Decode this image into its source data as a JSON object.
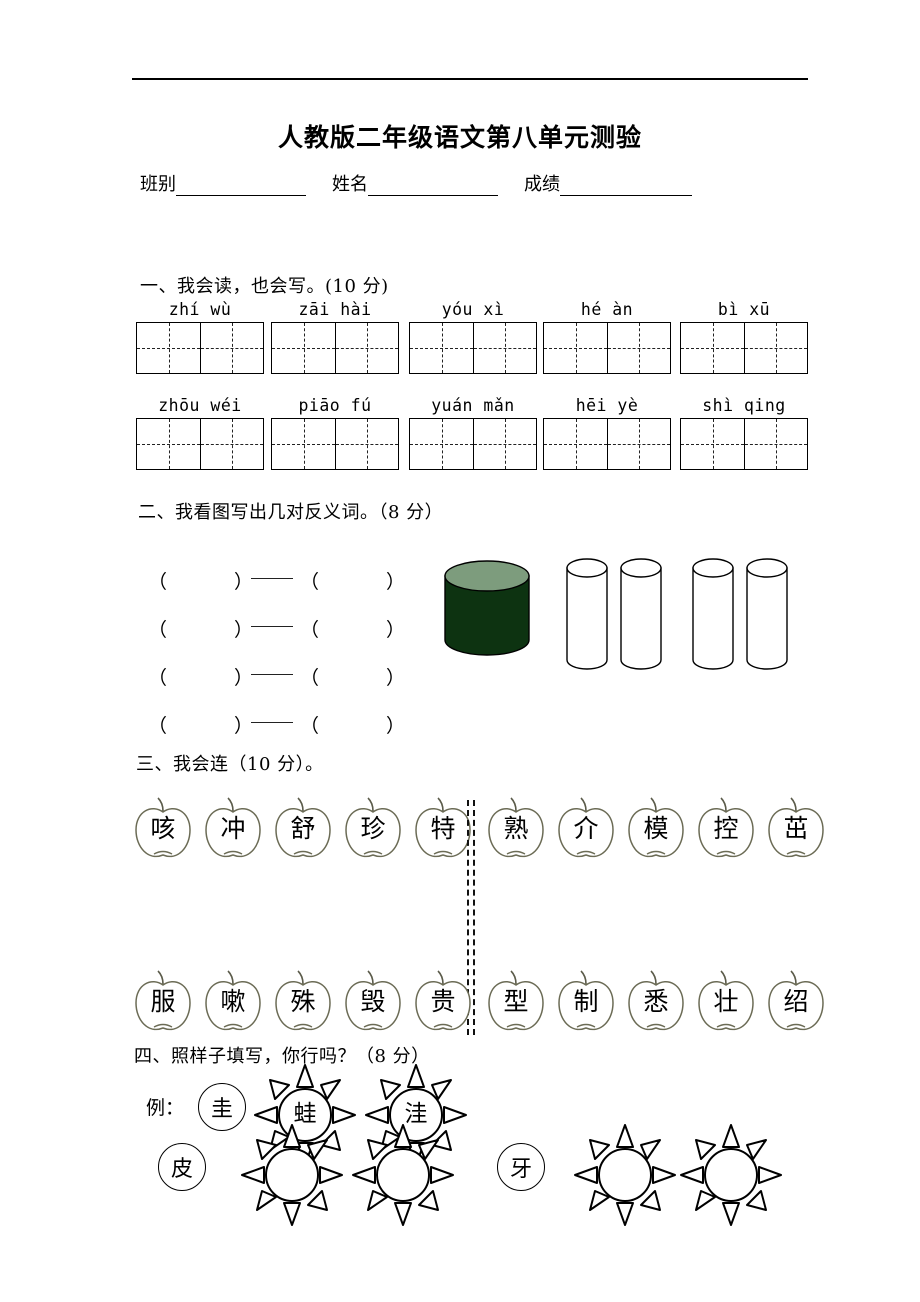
{
  "document": {
    "title": "人教版二年级语文第八单元测验",
    "header_fields": [
      {
        "label": "班别",
        "value": ""
      },
      {
        "label": "姓名",
        "value": ""
      },
      {
        "label": "成绩",
        "value": ""
      }
    ]
  },
  "sections": [
    {
      "heading": "一、我会读，也会写。(10 分)",
      "rows": [
        [
          {
            "pinyin": "zhí wù"
          },
          {
            "pinyin": "zāi hài"
          },
          {
            "pinyin": "yóu xì"
          },
          {
            "pinyin": "hé àn"
          },
          {
            "pinyin": "bì xū"
          }
        ],
        [
          {
            "pinyin": "zhōu wéi"
          },
          {
            "pinyin": "piāo fú"
          },
          {
            "pinyin": "yuán mǎn"
          },
          {
            "pinyin": "hēi yè"
          },
          {
            "pinyin": "shì qing"
          }
        ]
      ]
    },
    {
      "heading": "二、我看图写出几对反义词。（8 分）",
      "answer_rows": [
        {
          "left": "",
          "right": "",
          "connector": "——"
        },
        {
          "left": "",
          "right": "",
          "connector": "——"
        },
        {
          "left": "",
          "right": "",
          "connector": "——"
        },
        {
          "left": "",
          "right": "",
          "connector": "——"
        }
      ],
      "figure": {
        "description": "cylinders",
        "short_fat_cylinder": {
          "fill": "#0d3311",
          "top_fill": "#7d9c7d",
          "count": 1
        },
        "tall_thin_cylinders": {
          "fill": "#ffffff",
          "count": 4
        }
      }
    },
    {
      "heading": "三、我会连（10 分）。",
      "apple_rows": [
        {
          "left": [
            "咳",
            "冲",
            "舒",
            "珍",
            "特"
          ],
          "right": [
            "熟",
            "介",
            "模",
            "控",
            "茁"
          ]
        },
        {
          "left": [
            "服",
            "嗽",
            "殊",
            "毁",
            "贵"
          ],
          "right": [
            "型",
            "制",
            "悉",
            "壮",
            "绍"
          ]
        }
      ]
    },
    {
      "heading": "四、照样子填写，你行吗？（8 分）",
      "example_label": "例：",
      "example": {
        "base": "圭",
        "derived": [
          "蛙",
          "洼"
        ]
      },
      "problems": [
        {
          "base": "皮",
          "derived": [
            "",
            ""
          ]
        },
        {
          "base": "牙",
          "derived": [
            "",
            ""
          ]
        }
      ]
    }
  ]
}
